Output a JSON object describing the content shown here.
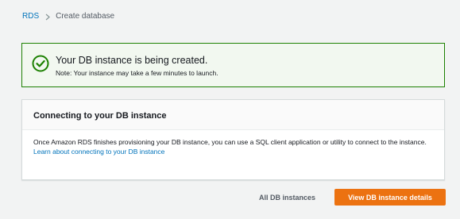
{
  "breadcrumb": {
    "root_label": "RDS",
    "current_label": "Create database"
  },
  "flash": {
    "status": "success",
    "icon": "check-circle-icon",
    "title": "Your DB instance is being created.",
    "note": "Note: Your instance may take a few minutes to launch."
  },
  "panel": {
    "title": "Connecting to your DB instance",
    "description": "Once Amazon RDS finishes provisioning your DB instance, you can use a SQL client application or utility to connect to the instance.",
    "link_label": "Learn about connecting to your DB instance"
  },
  "actions": {
    "secondary_label": "All DB instances",
    "primary_label": "View DB instance details"
  },
  "colors": {
    "background": "#f2f3f3",
    "link": "#0073bb",
    "success": "#1d8102",
    "success_bg": "#f2f8f0",
    "primary_button": "#ec7211"
  }
}
